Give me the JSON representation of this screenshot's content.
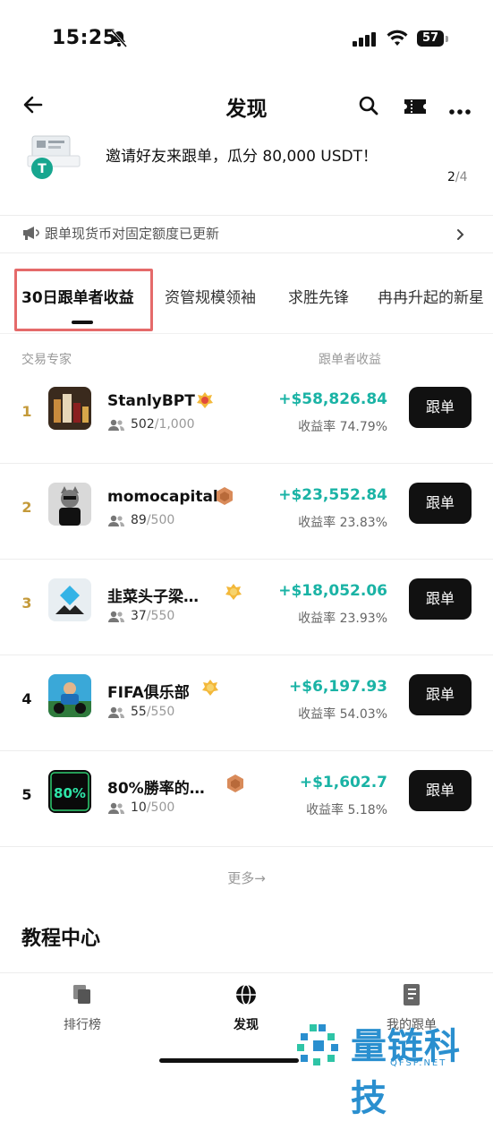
{
  "status": {
    "time": "15:25",
    "battery": "57"
  },
  "header": {
    "title": "发现"
  },
  "banner": {
    "text": "邀请好友来跟单，瓜分 80,000 USDT！",
    "page_current": "2",
    "page_total": "/4"
  },
  "notice": {
    "text": "跟单现货币对固定额度已更新"
  },
  "tabs": [
    {
      "label": "30日跟单者收益"
    },
    {
      "label": "资管规模领袖"
    },
    {
      "label": "求胜先锋"
    },
    {
      "label": "冉冉升起的新星"
    }
  ],
  "columns": {
    "expert": "交易专家",
    "profit": "跟单者收益"
  },
  "follow_label": "跟单",
  "roi_prefix": "收益率",
  "traders": [
    {
      "rank": "1",
      "name": "StanlyBPT",
      "badge": "gold",
      "followers": "502",
      "cap": "/1,000",
      "pnl": "+$58,826.84",
      "roi": "74.79%"
    },
    {
      "rank": "2",
      "name": "momocapital",
      "badge": "bronze",
      "followers": "89",
      "cap": "/500",
      "pnl": "+$23,552.84",
      "roi": "23.83%"
    },
    {
      "rank": "3",
      "name": "韭菜头子梁…",
      "badge": "gold",
      "followers": "37",
      "cap": "/550",
      "pnl": "+$18,052.06",
      "roi": "23.93%"
    },
    {
      "rank": "4",
      "name": "FIFA俱乐部",
      "badge": "gold",
      "followers": "55",
      "cap": "/550",
      "pnl": "+$6,197.93",
      "roi": "54.03%"
    },
    {
      "rank": "5",
      "name": "80%勝率的…",
      "badge": "bronze",
      "followers": "10",
      "cap": "/500",
      "pnl": "+$1,602.7",
      "roi": "5.18%"
    }
  ],
  "more_label": "更多→",
  "tutorial": {
    "title": "教程中心"
  },
  "nav": [
    {
      "label": "排行榜"
    },
    {
      "label": "发现"
    },
    {
      "label": "我的跟单"
    }
  ],
  "watermark": {
    "main": "量链科技",
    "sub": "QFSP.NET"
  },
  "colors": {
    "accent_teal": "#1ab3a5",
    "highlight_red": "#e56a6a",
    "button_black": "#111111",
    "watermark_blue": "#2a8fcf"
  }
}
